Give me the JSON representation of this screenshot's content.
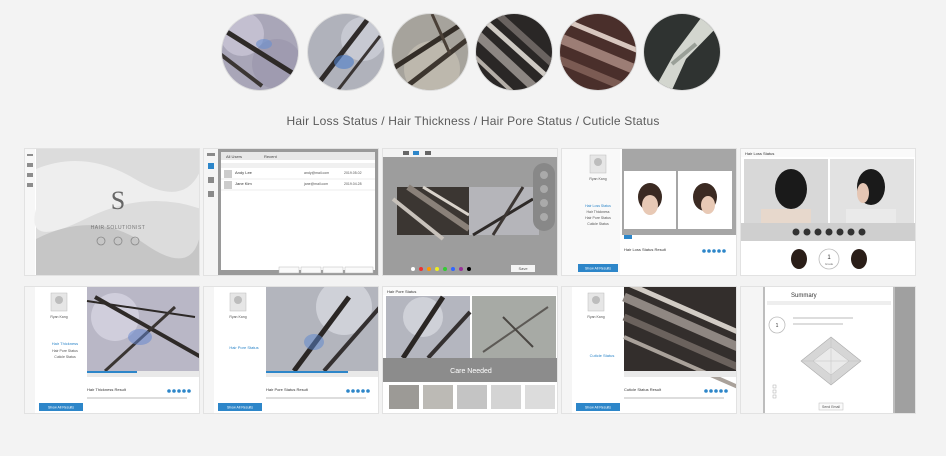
{
  "caption": "Hair Loss Status / Hair Thickness / Hair Pore Status / Cuticle Status",
  "circles": [
    {
      "name": "hair-loss-sample-1"
    },
    {
      "name": "hair-loss-sample-2"
    },
    {
      "name": "hair-loss-sample-3"
    },
    {
      "name": "hair-thickness-sample"
    },
    {
      "name": "hair-pore-sample"
    },
    {
      "name": "cuticle-sample"
    }
  ],
  "thumbs": {
    "t1": {
      "logo_letter": "S",
      "brand": "HAIR SOLUTIONIST",
      "menu": [
        "Home",
        "Camera",
        "Analysis"
      ]
    },
    "t2": {
      "tab_a": "All Users",
      "tab_b": "Recent",
      "rows": [
        {
          "name": "Andy Lee",
          "email": "andy@mail.com",
          "date": "2019.05.02"
        },
        {
          "name": "Jane Kim",
          "email": "jane@mail.com",
          "date": "2019.04.28"
        }
      ],
      "buttons": [
        "Add User",
        "Search",
        "Edit",
        "Delete",
        "New Analysis"
      ]
    },
    "t3": {
      "save": "Save"
    },
    "t4": {
      "user": "Ryan Kang",
      "menu_items": [
        "Hair Loss Status",
        "Hair Thickness",
        "Hair Pore Status",
        "Cuticle Status"
      ],
      "result_title": "Hair Loss Status Result",
      "btn": "Show All Results"
    },
    "t5": {
      "title": "Hair Loss Status",
      "score": "1",
      "score_label": "Grade"
    },
    "t6": {
      "user": "Ryan Kang",
      "menu_active": "Hair Thickness",
      "menu_items": [
        "Hair Pore Status",
        "Cuticle Status"
      ],
      "result_title": "Hair Thickness Result",
      "btn": "Show All Results"
    },
    "t7": {
      "user": "Ryan Kang",
      "menu_active": "Hair Pore Status",
      "result_title": "Hair Pore Status Result",
      "btn": "Show All Results"
    },
    "t8": {
      "title": "Hair Pore Status",
      "status": "Care Needed"
    },
    "t9": {
      "user": "Ryan Kang",
      "menu_active": "Cuticle Status",
      "result_title": "Cuticle Status Result",
      "btn": "Show All Results"
    },
    "t10": {
      "title": "Summary",
      "score": "1",
      "btn": "Send Email"
    }
  },
  "colors": {
    "accent": "#2d86c9",
    "panel": "#8f8f8f",
    "bg": "#f3f3f3"
  }
}
